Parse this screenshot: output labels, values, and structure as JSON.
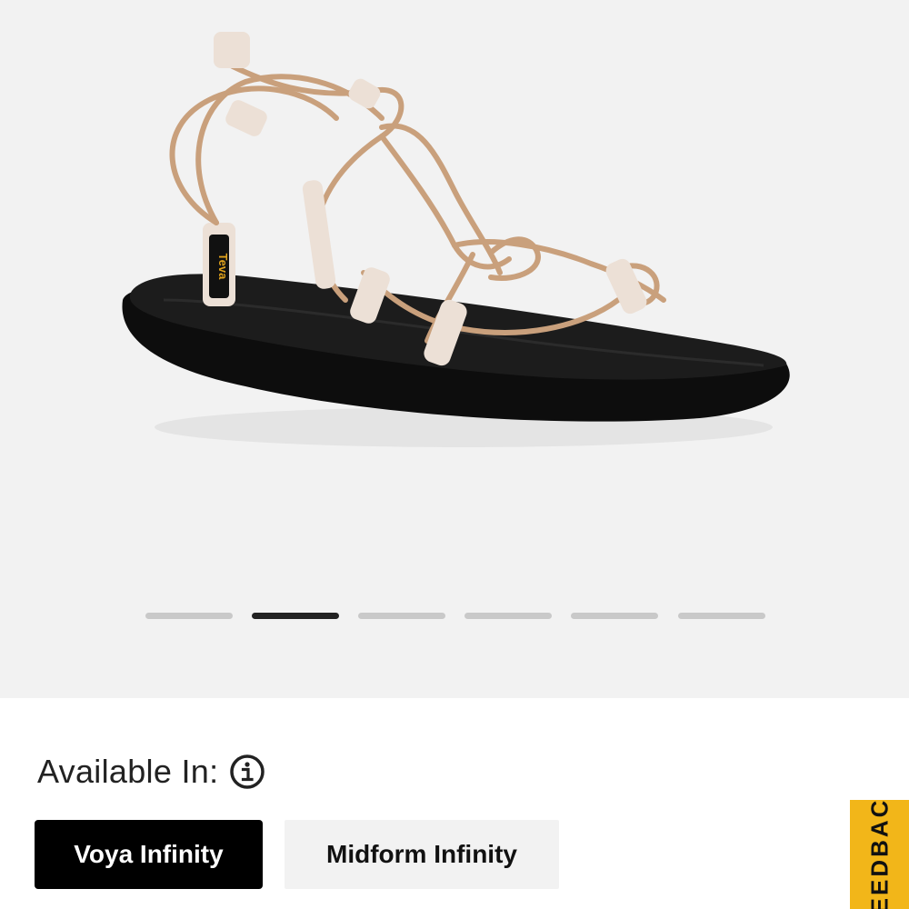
{
  "gallery": {
    "image_alt": "Teva Voya Infinity sandal",
    "logo_text": "Teva",
    "slide_count": 6,
    "active_slide": 2
  },
  "availability": {
    "label": "Available In:",
    "info_icon": "info-circle-icon"
  },
  "variants": [
    {
      "label": "Voya Infinity",
      "selected": true
    },
    {
      "label": "Midform Infinity",
      "selected": false
    }
  ],
  "feedback_tab": {
    "label": "FEEDBACK"
  },
  "colors": {
    "strap": "#c9a07c",
    "sole": "#111111",
    "accent": "#f2b619",
    "gallery_bg": "#f2f2f2"
  }
}
